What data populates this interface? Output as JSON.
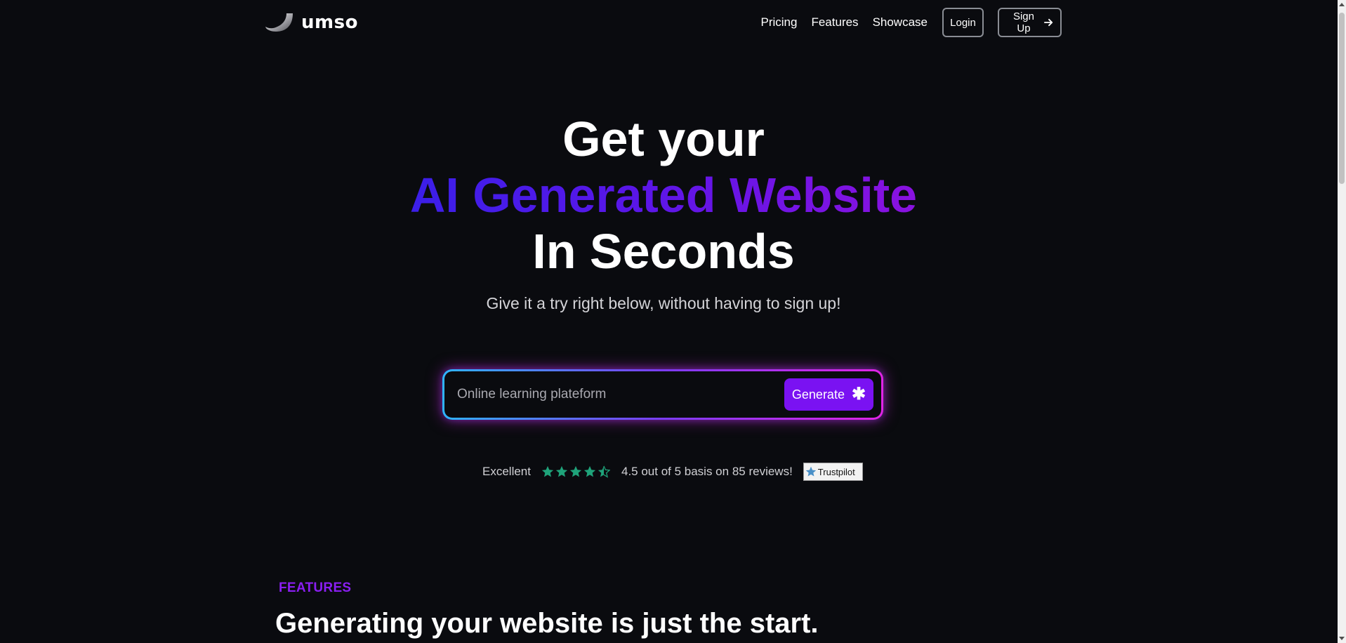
{
  "header": {
    "logo_text": "umso",
    "logo_icon": "umso-swoosh-logo",
    "nav_links": [
      "Pricing",
      "Features",
      "Showcase"
    ],
    "login_label": "Login",
    "signup_label": "Sign Up",
    "signup_icon": "arrow-right-icon"
  },
  "hero": {
    "line1": "Get your",
    "line2": "AI Generated Website",
    "line3": "In Seconds",
    "subtitle": "Give it a try right below, without having to sign up!",
    "gradient_colors": [
      "#3b1fe8",
      "#8a12e0"
    ]
  },
  "generator": {
    "input_value": "",
    "input_placeholder": "Online learning plateform",
    "button_label": "Generate",
    "button_icon": "sparkle-icon",
    "button_color": "#7a12f2",
    "border_gradient": [
      "#2fb4ff",
      "#7b3cf5",
      "#e024e6"
    ]
  },
  "rating": {
    "label": "Excellent",
    "stars": 4.5,
    "star_color": "#1fa37a",
    "text": "4.5 out of 5 basis on 85 reviews!",
    "badge_label": "Trustpilot"
  },
  "features": {
    "eyebrow": "FEATURES",
    "heading": "Generating your website is just the start.",
    "accent_color": "#8a1ef2"
  }
}
